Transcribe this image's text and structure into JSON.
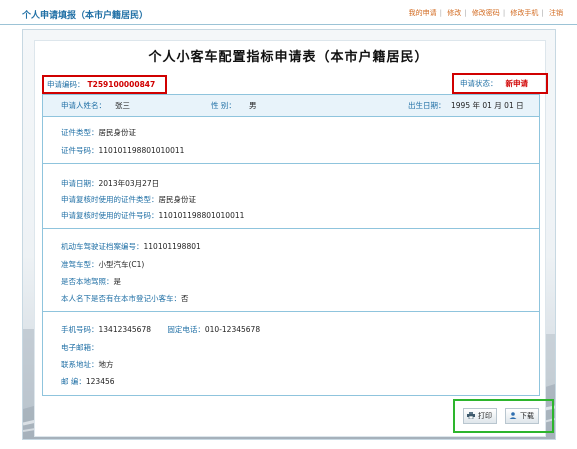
{
  "header": {
    "title": "个人申请填报（本市户籍居民）",
    "nav": [
      "我的申请",
      "修改",
      "修改密码",
      "修改手机",
      "注销"
    ]
  },
  "form": {
    "title": "个人小客车配置指标申请表（本市户籍居民）",
    "application_no": {
      "label": "申请编码：",
      "value": "T259100000847"
    },
    "status": {
      "label": "申请状态：",
      "value": "新申请"
    },
    "applicant": {
      "name_label": "申请人姓名：",
      "name": "张三",
      "gender_label": "性  别：",
      "gender": "男",
      "birth_label": "出生日期：",
      "birth": "1995 年 01 月 01 日"
    },
    "id_section": {
      "type_label": "证件类型：",
      "type": "居民身份证",
      "number_label": "证件号码：",
      "number": "110101198801010011"
    },
    "apply_section": {
      "date_label": "申请日期：",
      "date": "2013年03月27日",
      "doc_type_label": "申请复核时使用的证件类型：",
      "doc_type": "居民身份证",
      "doc_no_label": "申请复核时使用的证件号码：",
      "doc_no": "110101198801010011"
    },
    "license_section": {
      "file_no_label": "机动车驾驶证档案编号：",
      "file_no": "110101198801",
      "class_label": "准驾车型：",
      "class": "小型汽车(C1)",
      "local_label": "是否本地驾照：",
      "local": "是",
      "owned_label": "本人名下是否有在本市登记小客车：",
      "owned": "否"
    },
    "contact_section": {
      "mobile_label": "手机号码：",
      "mobile": "13412345678",
      "phone_label": "固定电话：",
      "phone": "010-12345678",
      "email_label": "电子邮箱：",
      "email": "",
      "address_label": "联系地址：",
      "address": "地方",
      "postcode_label": "邮    编：",
      "postcode": "123456"
    }
  },
  "buttons": {
    "print": "打印",
    "download": "下载"
  },
  "colors": {
    "accent": "#1f6fa5",
    "alert": "#d00000",
    "highlight": "#2db52d",
    "nav": "#d2691e"
  }
}
